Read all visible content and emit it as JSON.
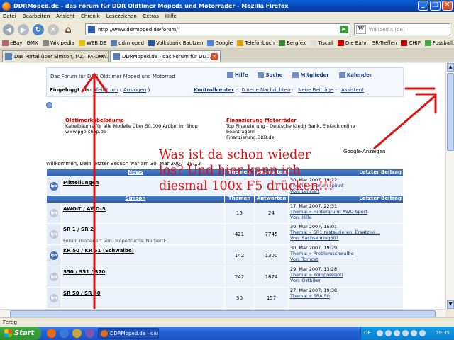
{
  "window": {
    "title": "DDRMoped.de - das Forum für DDR Oldtimer Mopeds und Motorräder - Mozilla Firefox",
    "buttons": [
      "_",
      "□",
      "✕"
    ]
  },
  "menu": [
    "Datei",
    "Bearbeiten",
    "Ansicht",
    "Chronik",
    "Lesezeichen",
    "Extras",
    "Hilfe"
  ],
  "navigation": {
    "url": "http://www.ddrmoped.de/forum/",
    "search_placeholder": "Wikipedia (de)",
    "search_logo": "W"
  },
  "bookmarks": [
    "eBay",
    "GMX",
    "Wikipedia",
    "WEB.DE",
    "ddrmoped",
    "Volksbank Bautzen",
    "Google",
    "Telefonbuch",
    "Bergfex",
    "Tiscali",
    "Die Bahn",
    "SR-Treffen",
    "CHIP",
    "Fussball.de"
  ],
  "tabs": [
    {
      "label": "Das Portal über Simson, MZ, IFA-DKW...",
      "active": false
    },
    {
      "label": "DDRMoped.de - das Forum für DD...",
      "active": true
    }
  ],
  "forum_header": {
    "title": "Das Forum für DDR Oldtimer Moped und Motorrad",
    "links": [
      "Hilfe",
      "Suche",
      "Mitglieder",
      "Kalender"
    ],
    "logged_in_label": "Eingeloggt als:",
    "username": "pfeilsturm",
    "logout": "Auslogen",
    "control_center": "Kontrollcenter",
    "new_messages": "0 neue Nachrichten",
    "new_posts": "Neue Beiträge",
    "assistant": "Assistent"
  },
  "ads": [
    {
      "title": "Oldtimerkabelbäume",
      "line1": "Kabelbäume für alle Modelle Über 50.000 Artikel im Shop",
      "line2": "www.pge-shop.de"
    },
    {
      "title": "Finanzierung Motorräder",
      "line1": "Top Finanzierung - Deutsche Kredit Bank. Einfach online",
      "line2": "beantragen!",
      "line3": "Finanzierung.DKB.de"
    }
  ],
  "google_ads": "Google-Anzeigen",
  "welcome": "Willkommen, Dein letzter Besuch war am 30. Mar 2007, 19:13",
  "table": {
    "news_header": {
      "category": "News",
      "topics": "Themen",
      "replies": "Antworten",
      "last": "Letzter Beitrag"
    },
    "news_rows": [
      {
        "name": "Mitteilungen",
        "moderators": "",
        "topics": "",
        "replies": "",
        "last_date": "30. Mar 2007, 19:22",
        "last_topic": "Thema: » Forum spinnt",
        "last_by": "Von: Lennart"
      }
    ],
    "simson_header": {
      "category": "Simson",
      "topics": "Themen",
      "replies": "Antworten",
      "last": "Letzter Beitrag"
    },
    "simson_rows": [
      {
        "name": "AWO-T / AWO-S",
        "moderators": "",
        "topics": "15",
        "replies": "24",
        "last_date": "17. Mar 2007, 22:31",
        "last_topic": "Thema: » Hintergrund AWO Sport",
        "last_by": "Von: Hille"
      },
      {
        "name": "SR 1 / SR 2",
        "moderators": "Forum moderiert von: Mopedfuchs, NorbertE",
        "topics": "421",
        "replies": "7745",
        "last_date": "30. Mar 2007, 15:01",
        "last_topic": "Thema: » SR1 restaurieren, Ersatztei...",
        "last_by": "Von: Sachsenring601"
      },
      {
        "name": "KR 50 / KR 51 (Schwalbe)",
        "moderators": "",
        "topics": "142",
        "replies": "1300",
        "last_date": "30. Mar 2007, 19:29",
        "last_topic": "Thema: » Problemschwalbe",
        "last_by": "Von: Tomcat"
      },
      {
        "name": "S50 / S51 / S70",
        "moderators": "",
        "topics": "242",
        "replies": "1874",
        "last_date": "29. Mar 2007, 13:28",
        "last_topic": "Thema: » Kompression",
        "last_by": "Von: Ostbiker"
      },
      {
        "name": "SR 50 / SR 80",
        "moderators": "",
        "topics": "30",
        "replies": "157",
        "last_date": "27. Mar 2007, 19:38",
        "last_topic": "Thema: » SRA 50",
        "last_by": ""
      }
    ]
  },
  "annotation": {
    "line1": "Was ist da schon wieder",
    "line2": "los? Und hier kann ich",
    "line3": "diesmal 100x F5 drücken!!!"
  },
  "status": "Fertig",
  "taskbar": {
    "start": "Start",
    "task": "DDRMoped.de - das ...",
    "lang": "DE",
    "clock": "19:35"
  },
  "colors": {
    "annotation": "#e01010",
    "category_header": "#2a5aa8",
    "row_bg": "#edf2fa"
  }
}
